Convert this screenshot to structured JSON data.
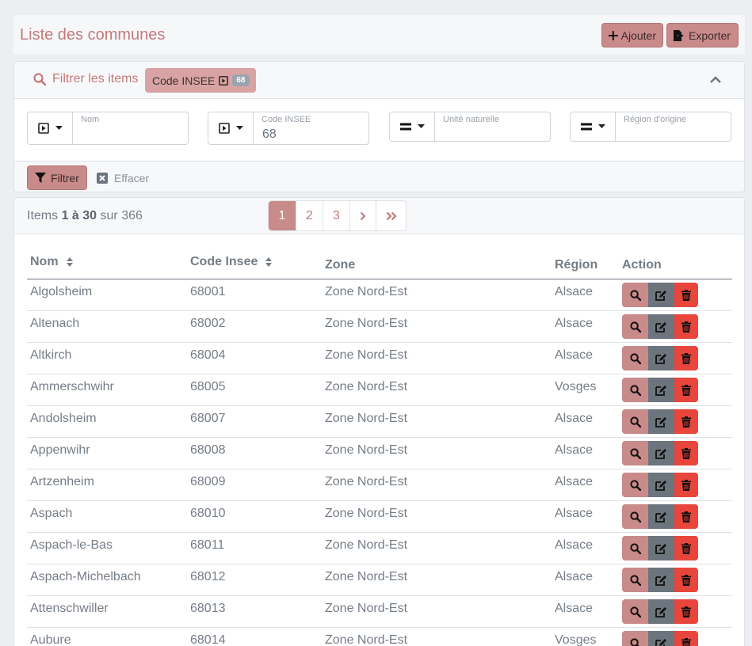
{
  "header": {
    "title": "Liste des communes",
    "add_label": "Ajouter",
    "export_label": "Exporter"
  },
  "filter": {
    "title": "Filtrer les items",
    "chip_label": "Code INSEE",
    "chip_badge": "68",
    "fields": [
      {
        "label": "Nom",
        "value": "",
        "operator_icon": "contains-icon"
      },
      {
        "label": "Code INSEE",
        "value": "68",
        "operator_icon": "contains-icon"
      },
      {
        "label": "Unité naturelle",
        "value": "",
        "operator_icon": "equals-icon"
      },
      {
        "label": "Région d'origine",
        "value": "",
        "operator_icon": "equals-icon"
      }
    ],
    "filter_button": "Filtrer",
    "clear_button": "Effacer"
  },
  "list": {
    "items_prefix": "Items",
    "items_range": "1 à 30",
    "items_of": "sur",
    "items_total": "366",
    "pages": [
      "1",
      "2",
      "3"
    ],
    "current_page": "1",
    "columns": {
      "nom": "Nom",
      "code": "Code Insee",
      "zone": "Zone",
      "region": "Région",
      "action": "Action"
    },
    "rows": [
      {
        "nom": "Algolsheim",
        "code": "68001",
        "zone": "Zone Nord-Est",
        "region": "Alsace"
      },
      {
        "nom": "Altenach",
        "code": "68002",
        "zone": "Zone Nord-Est",
        "region": "Alsace"
      },
      {
        "nom": "Altkirch",
        "code": "68004",
        "zone": "Zone Nord-Est",
        "region": "Alsace"
      },
      {
        "nom": "Ammerschwihr",
        "code": "68005",
        "zone": "Zone Nord-Est",
        "region": "Vosges"
      },
      {
        "nom": "Andolsheim",
        "code": "68007",
        "zone": "Zone Nord-Est",
        "region": "Alsace"
      },
      {
        "nom": "Appenwihr",
        "code": "68008",
        "zone": "Zone Nord-Est",
        "region": "Alsace"
      },
      {
        "nom": "Artzenheim",
        "code": "68009",
        "zone": "Zone Nord-Est",
        "region": "Alsace"
      },
      {
        "nom": "Aspach",
        "code": "68010",
        "zone": "Zone Nord-Est",
        "region": "Alsace"
      },
      {
        "nom": "Aspach-le-Bas",
        "code": "68011",
        "zone": "Zone Nord-Est",
        "region": "Alsace"
      },
      {
        "nom": "Aspach-Michelbach",
        "code": "68012",
        "zone": "Zone Nord-Est",
        "region": "Alsace"
      },
      {
        "nom": "Attenschwiller",
        "code": "68013",
        "zone": "Zone Nord-Est",
        "region": "Alsace"
      },
      {
        "nom": "Aubure",
        "code": "68014",
        "zone": "Zone Nord-Est",
        "region": "Vosges"
      }
    ]
  },
  "colors": {
    "accent": "#c98a8a",
    "accent_text": "#c37a7a",
    "edit": "#6c757d",
    "delete": "#e8453c"
  }
}
